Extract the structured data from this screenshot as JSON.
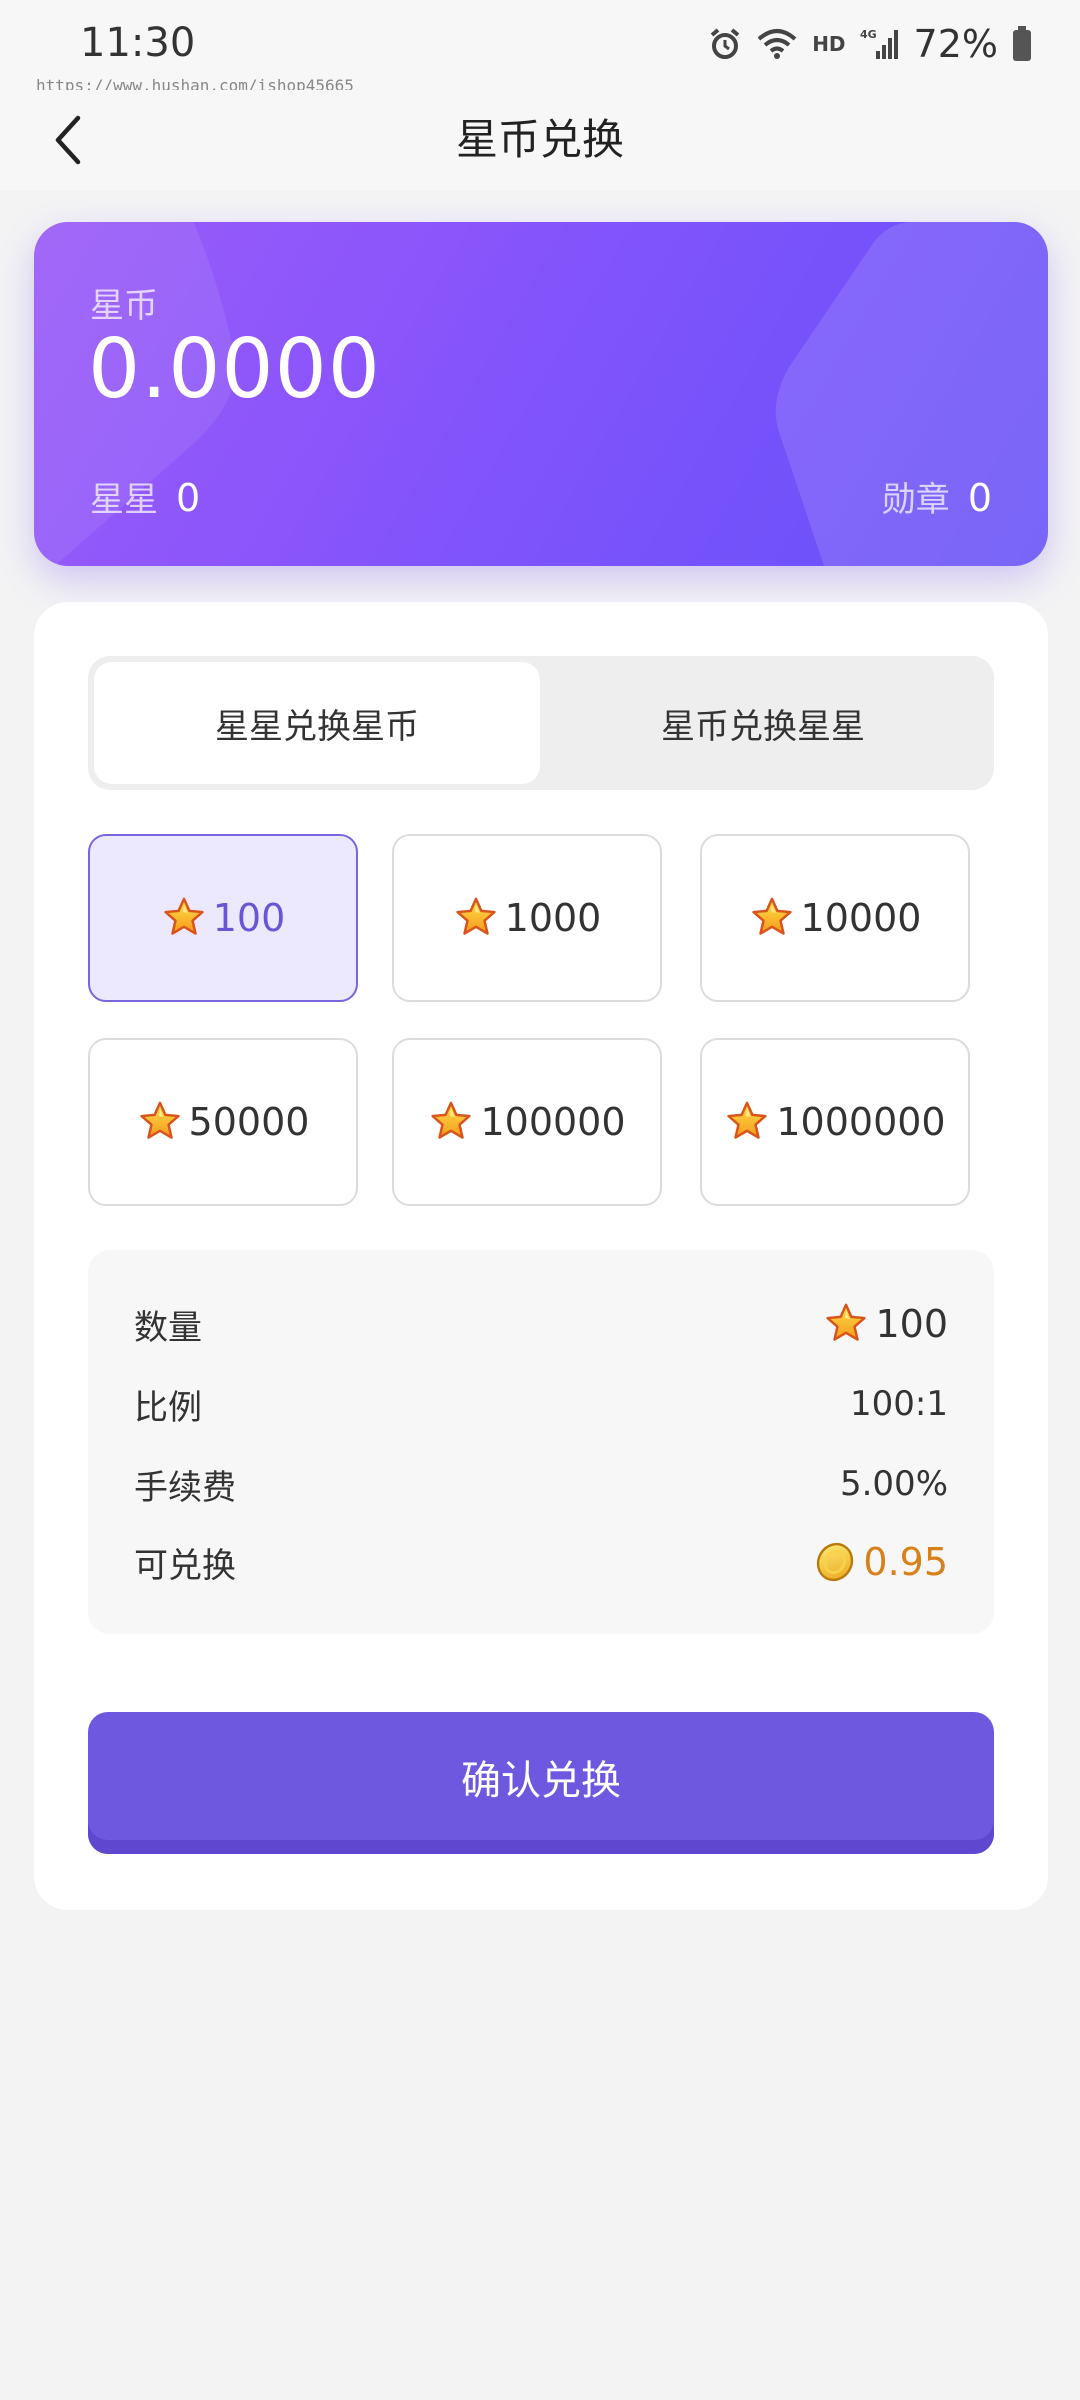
{
  "status": {
    "time": "11:30",
    "network_label": "HD",
    "cell_label": "4G",
    "battery": "72%"
  },
  "watermark": "https://www.hushan.com/ishop45665",
  "header": {
    "title": "星币兑换"
  },
  "balance": {
    "label": "星币",
    "value": "0.0000",
    "stars_label": "星星",
    "stars_value": "0",
    "medal_label": "勋章",
    "medal_value": "0"
  },
  "tabs": [
    {
      "label": "星星兑换星币",
      "active": true
    },
    {
      "label": "星币兑换星星",
      "active": false
    }
  ],
  "amounts": [
    {
      "value": "100",
      "selected": true
    },
    {
      "value": "1000",
      "selected": false
    },
    {
      "value": "10000",
      "selected": false
    },
    {
      "value": "50000",
      "selected": false
    },
    {
      "value": "100000",
      "selected": false
    },
    {
      "value": "1000000",
      "selected": false
    }
  ],
  "summary": {
    "quantity_label": "数量",
    "quantity_value": "100",
    "ratio_label": "比例",
    "ratio_value": "100:1",
    "fee_label": "手续费",
    "fee_value": "5.00%",
    "receivable_label": "可兑换",
    "receivable_value": "0.95"
  },
  "confirm_label": "确认兑换",
  "colors": {
    "accent": "#6f58e0",
    "card_gradient_start": "#9a5cf8",
    "card_gradient_end": "#6651f7",
    "gold_text": "#d8801a"
  },
  "icons": {
    "amount_icon": "star-icon",
    "receivable_icon": "coin-icon"
  }
}
